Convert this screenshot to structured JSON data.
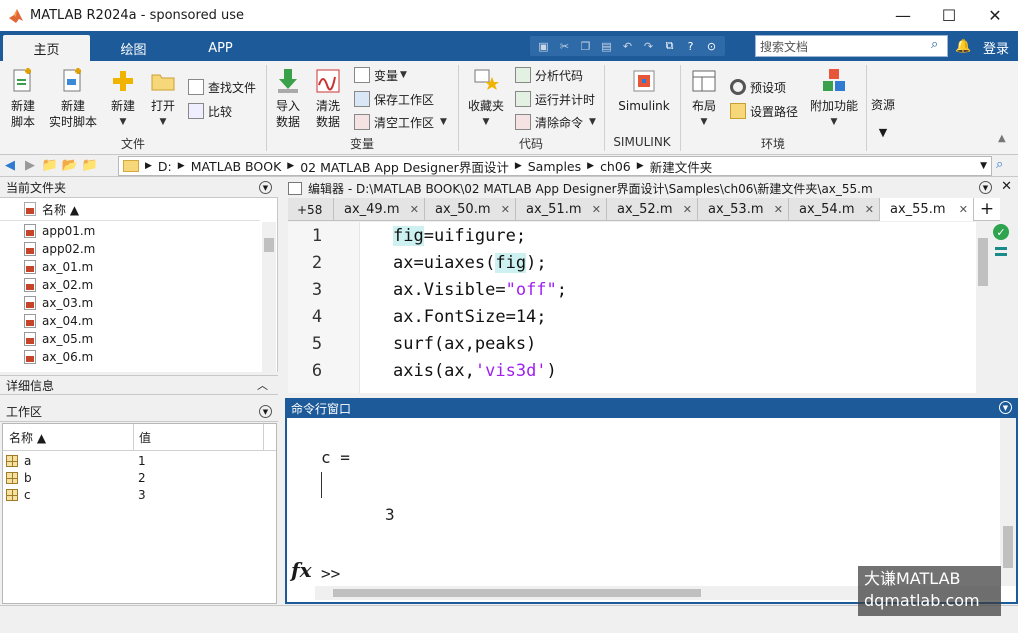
{
  "window": {
    "title": "MATLAB R2024a - sponsored use",
    "minimize": "—",
    "maximize": "☐",
    "close": "✕"
  },
  "tabs": [
    "主页",
    "绘图",
    "APP"
  ],
  "search": {
    "placeholder": "搜索文档"
  },
  "login": "登录",
  "ribbon": {
    "file": {
      "new_script": [
        "新建",
        "脚本"
      ],
      "new_live": [
        "新建",
        "实时脚本"
      ],
      "new": "新建",
      "open": "打开",
      "find_files": "查找文件",
      "compare": "比较",
      "group": "文件"
    },
    "variable": {
      "import": [
        "导入",
        "数据"
      ],
      "clean": [
        "清洗",
        "数据"
      ],
      "variable": "变量",
      "save_ws": "保存工作区",
      "clear_ws": "清空工作区",
      "group": "变量"
    },
    "code": {
      "favorites": "收藏夹",
      "analyze": "分析代码",
      "run_time": "运行并计时",
      "clear_cmds": "清除命令",
      "group": "代码"
    },
    "simulink": {
      "label": "Simulink",
      "group": "SIMULINK"
    },
    "env": {
      "layout": "布局",
      "prefs": "预设项",
      "set_path": "设置路径",
      "addons": "附加功能",
      "group": "环境"
    },
    "resources": "资源"
  },
  "path": [
    "D:",
    "MATLAB BOOK",
    "02 MATLAB App Designer界面设计",
    "Samples",
    "ch06",
    "新建文件夹"
  ],
  "current_folder": {
    "title": "当前文件夹",
    "col_name": "名称 ▲",
    "files": [
      "app01.m",
      "app02.m",
      "ax_01.m",
      "ax_02.m",
      "ax_03.m",
      "ax_04.m",
      "ax_05.m",
      "ax_06.m"
    ],
    "details": "详细信息"
  },
  "workspace": {
    "title": "工作区",
    "col_name": "名称 ▲",
    "col_value": "值",
    "rows": [
      {
        "name": "a",
        "value": "1"
      },
      {
        "name": "b",
        "value": "2"
      },
      {
        "name": "c",
        "value": "3"
      }
    ]
  },
  "editor": {
    "title": "编辑器 - D:\\MATLAB BOOK\\02 MATLAB App Designer界面设计\\Samples\\ch06\\新建文件夹\\ax_55.m",
    "overflow": "+58",
    "tabs": [
      "ax_49.m",
      "ax_50.m",
      "ax_51.m",
      "ax_52.m",
      "ax_53.m",
      "ax_54.m",
      "ax_55.m"
    ],
    "active_tab": "ax_55.m",
    "lines": [
      "1",
      "2",
      "3",
      "4",
      "5",
      "6"
    ]
  },
  "command": {
    "title": "命令行窗口",
    "output_var": "c =",
    "output_val": "3",
    "prompt": ">>"
  },
  "watermark": [
    "大谦MATLAB",
    "dqmatlab.com"
  ]
}
